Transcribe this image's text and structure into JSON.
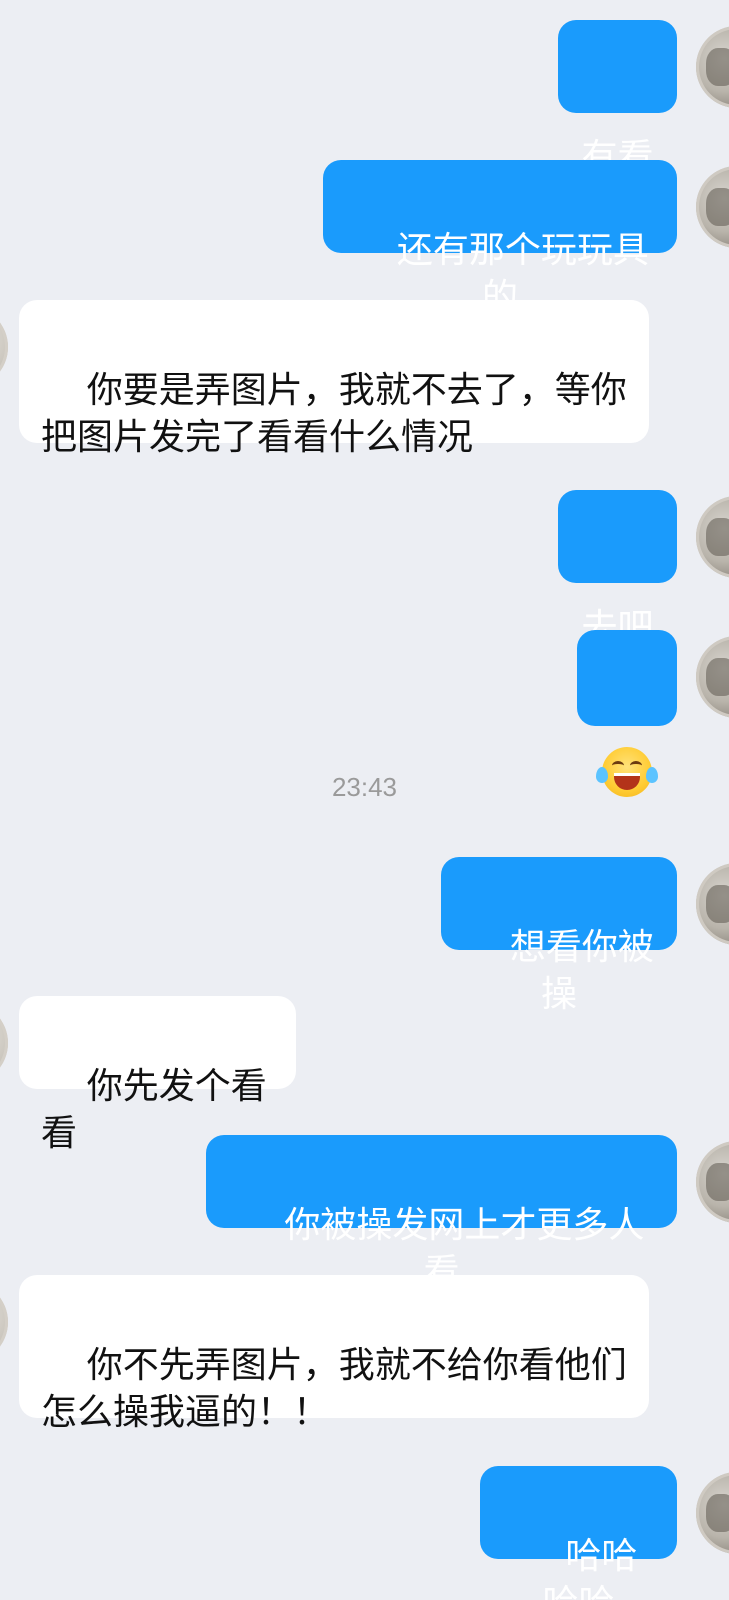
{
  "messages": [
    {
      "text": "有看"
    },
    {
      "text": "还有那个玩玩具的"
    },
    {
      "text": "你要是弄图片，我就不去了，等你把图片发完了看看什么情况"
    },
    {
      "text": "去吧"
    },
    {
      "emoji": "tears-of-joy-emoji"
    },
    {
      "text": "想看你被操"
    },
    {
      "text": "你先发个看看"
    },
    {
      "text": "你被操发网上才更多人看"
    },
    {
      "text": "你不先弄图片，我就不给你看他们怎么操我逼的！！"
    },
    {
      "text": "哈哈哈哈"
    }
  ],
  "timestamp": "23:43",
  "colors": {
    "background": "#eceef3",
    "outgoing_bubble": "#1a9bfc",
    "incoming_bubble": "#ffffff",
    "timestamp_text": "#9a9a9a"
  }
}
